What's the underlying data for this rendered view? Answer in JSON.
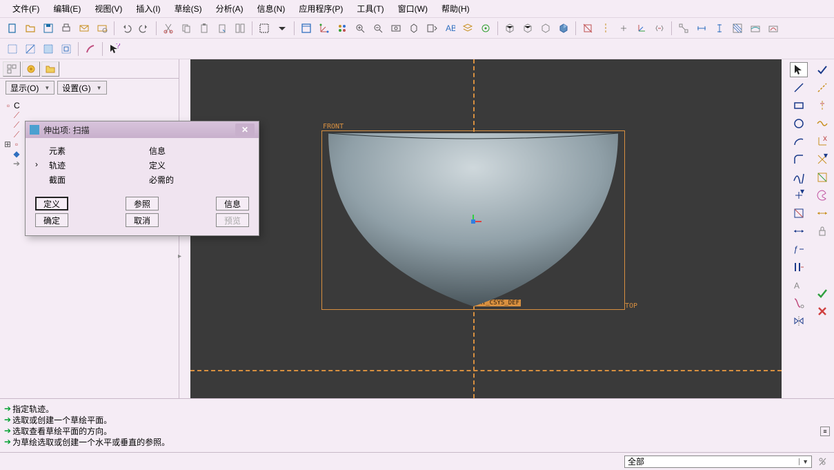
{
  "menu": {
    "file": "文件(F)",
    "edit": "编辑(E)",
    "view": "视图(V)",
    "insert": "插入(I)",
    "sketch": "草绘(S)",
    "analysis": "分析(A)",
    "info": "信息(N)",
    "app": "应用程序(P)",
    "tools": "工具(T)",
    "window": "窗口(W)",
    "help": "帮助(H)"
  },
  "selectors": {
    "display": "显示(O)",
    "settings": "设置(G)"
  },
  "viewport": {
    "front": "FRONT",
    "top": "TOP",
    "csys": "PRT_CSYS_DEF"
  },
  "dialog": {
    "title": "伸出项: 扫描",
    "col_element": "元素",
    "col_info": "信息",
    "row1_el": "轨迹",
    "row1_info": "定义",
    "row2_el": "截面",
    "row2_info": "必需的",
    "btn_define": "定义",
    "btn_ref": "参照",
    "btn_info": "信息",
    "btn_ok": "确定",
    "btn_cancel": "取消",
    "btn_preview": "预览"
  },
  "messages": {
    "m1": "指定轨迹。",
    "m2": "选取或创建一个草绘平面。",
    "m3": "选取查看草绘平面的方向。",
    "m4": "为草绘选取或创建一个水平或垂直的参照。"
  },
  "status": {
    "filter": "全部"
  }
}
